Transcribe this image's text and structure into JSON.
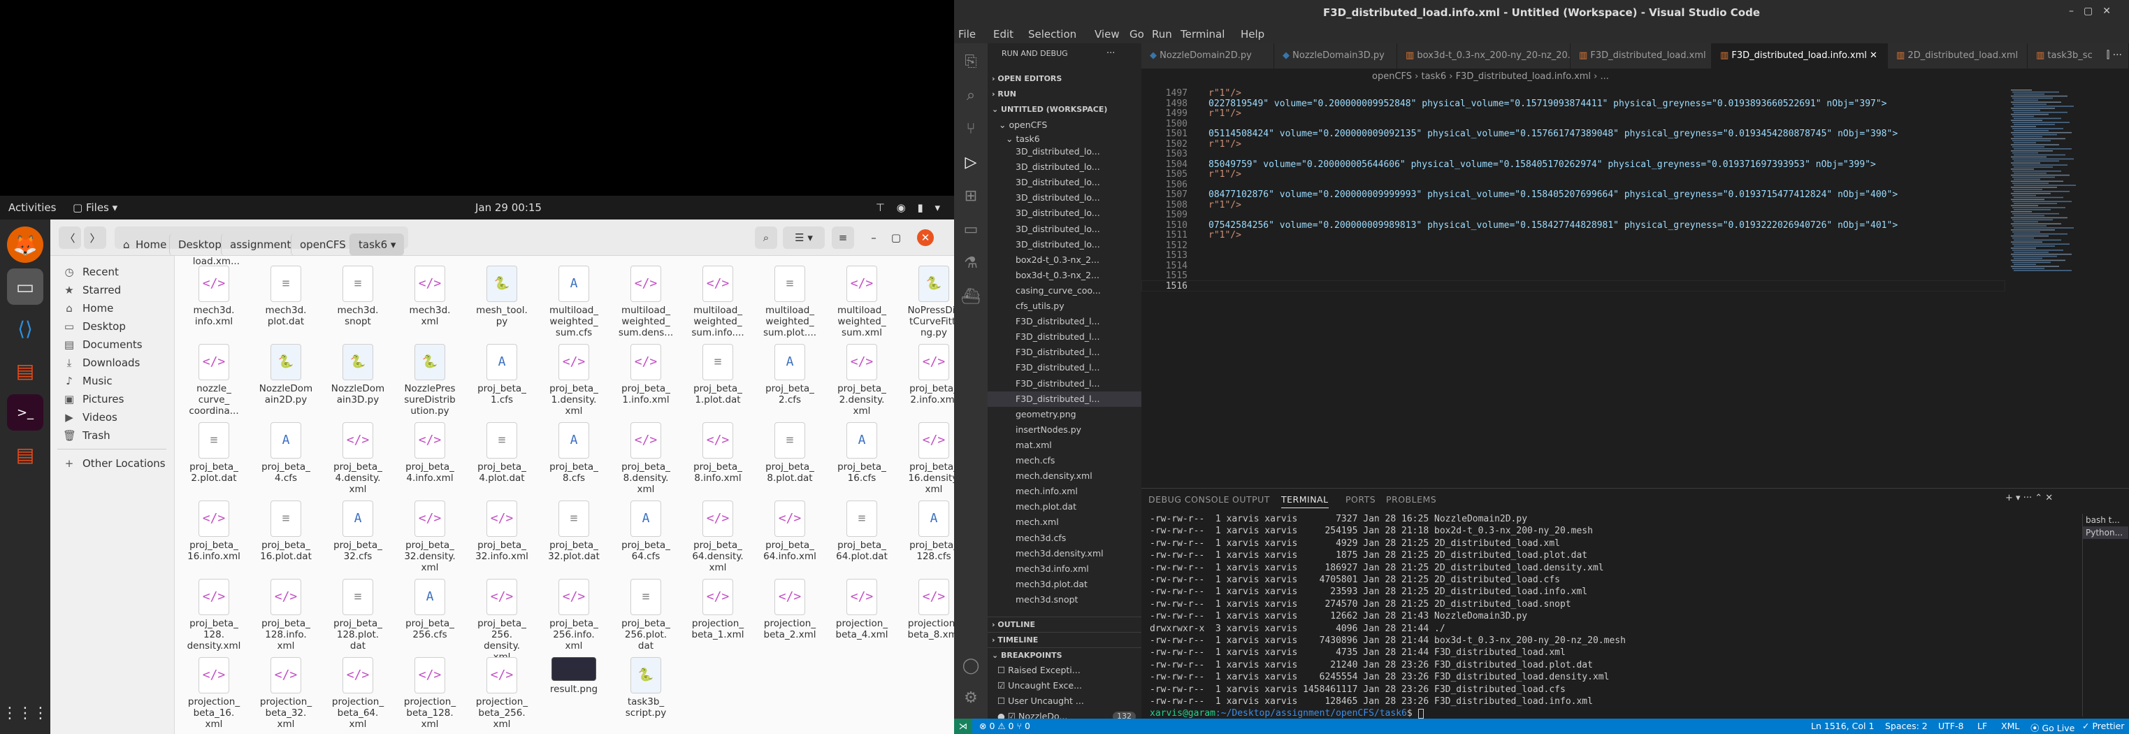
{
  "desktop": {
    "topbar": {
      "activities": "Activities",
      "app": "Files",
      "clock": "Jan 29  00:15",
      "tray": "⊤ ◉ ▮ ▾"
    }
  },
  "files": {
    "nav": {
      "back": "〈",
      "forward": "〉"
    },
    "breadcrumb": [
      "Home",
      "Desktop",
      "assignment",
      "openCFS",
      "task6"
    ],
    "sidebar": [
      {
        "label": "Recent",
        "icon": "clock-icon"
      },
      {
        "label": "Starred",
        "icon": "star-icon"
      },
      {
        "label": "Home",
        "icon": "home-icon"
      },
      {
        "label": "Desktop",
        "icon": "desktop-icon"
      },
      {
        "label": "Documents",
        "icon": "document-icon"
      },
      {
        "label": "Downloads",
        "icon": "download-icon"
      },
      {
        "label": "Music",
        "icon": "music-icon"
      },
      {
        "label": "Pictures",
        "icon": "picture-icon"
      },
      {
        "label": "Videos",
        "icon": "video-icon"
      },
      {
        "label": "Trash",
        "icon": "trash-icon"
      },
      {
        "label": "Other Locations",
        "icon": "plus-icon"
      }
    ],
    "partial_top": "_load.xm...",
    "items": [
      [
        "mech3d.\ninfo.xml",
        "xml"
      ],
      [
        "mech3d.\nplot.dat",
        "txt"
      ],
      [
        "mech3d.\nsnopt",
        "txt"
      ],
      [
        "mech3d.\nxml",
        "xml"
      ],
      [
        "mesh_tool.\npy",
        "py"
      ],
      [
        "multiload_\nweighted_\nsum.cfs",
        "cfs"
      ],
      [
        "multiload_\nweighted_\nsum.dens...",
        "xml"
      ],
      [
        "multiload_\nweighted_\nsum.info....",
        "xml"
      ],
      [
        "multiload_\nweighted_\nsum.plot....",
        "txt"
      ],
      [
        "multiload_\nweighted_\nsum.xml",
        "xml"
      ],
      [
        "NoPressDis\ntCurveFitti\nng.py",
        "py"
      ],
      [
        "nozzle_\ncurve_\ncoordina...",
        "xml"
      ],
      [
        "NozzleDom\nain2D.py",
        "py"
      ],
      [
        "NozzleDom\nain3D.py",
        "py"
      ],
      [
        "NozzlePres\nsureDistrib\nution.py",
        "py"
      ],
      [
        "proj_beta_\n1.cfs",
        "cfs"
      ],
      [
        "proj_beta_\n1.density.\nxml",
        "xml"
      ],
      [
        "proj_beta_\n1.info.xml",
        "xml"
      ],
      [
        "proj_beta_\n1.plot.dat",
        "txt"
      ],
      [
        "proj_beta_\n2.cfs",
        "cfs"
      ],
      [
        "proj_beta_\n2.density.\nxml",
        "xml"
      ],
      [
        "proj_beta_\n2.info.xml",
        "xml"
      ],
      [
        "proj_beta_\n2.plot.dat",
        "txt"
      ],
      [
        "proj_beta_\n4.cfs",
        "cfs"
      ],
      [
        "proj_beta_\n4.density.\nxml",
        "xml"
      ],
      [
        "proj_beta_\n4.info.xml",
        "xml"
      ],
      [
        "proj_beta_\n4.plot.dat",
        "txt"
      ],
      [
        "proj_beta_\n8.cfs",
        "cfs"
      ],
      [
        "proj_beta_\n8.density.\nxml",
        "xml"
      ],
      [
        "proj_beta_\n8.info.xml",
        "xml"
      ],
      [
        "proj_beta_\n8.plot.dat",
        "txt"
      ],
      [
        "proj_beta_\n16.cfs",
        "cfs"
      ],
      [
        "proj_beta_\n16.density.\nxml",
        "xml"
      ],
      [
        "proj_beta_\n16.info.xml",
        "xml"
      ],
      [
        "proj_beta_\n16.plot.dat",
        "txt"
      ],
      [
        "proj_beta_\n32.cfs",
        "cfs"
      ],
      [
        "proj_beta_\n32.density.\nxml",
        "xml"
      ],
      [
        "proj_beta_\n32.info.xml",
        "xml"
      ],
      [
        "proj_beta_\n32.plot.dat",
        "txt"
      ],
      [
        "proj_beta_\n64.cfs",
        "cfs"
      ],
      [
        "proj_beta_\n64.density.\nxml",
        "xml"
      ],
      [
        "proj_beta_\n64.info.xml",
        "xml"
      ],
      [
        "proj_beta_\n64.plot.dat",
        "txt"
      ],
      [
        "proj_beta_\n128.cfs",
        "cfs"
      ],
      [
        "proj_beta_\n128.\ndensity.xml",
        "xml"
      ],
      [
        "proj_beta_\n128.info.\nxml",
        "xml"
      ],
      [
        "proj_beta_\n128.plot.\ndat",
        "txt"
      ],
      [
        "proj_beta_\n256.cfs",
        "cfs"
      ],
      [
        "proj_beta_\n256.\ndensity.\nxml",
        "xml"
      ],
      [
        "proj_beta_\n256.info.\nxml",
        "xml"
      ],
      [
        "proj_beta_\n256.plot.\ndat",
        "txt"
      ],
      [
        "projection_\nbeta_1.xml",
        "xml"
      ],
      [
        "projection_\nbeta_2.xml",
        "xml"
      ],
      [
        "projection_\nbeta_4.xml",
        "xml"
      ],
      [
        "projection_\nbeta_8.xml",
        "xml"
      ],
      [
        "projection_\nbeta_16.\nxml",
        "xml"
      ],
      [
        "projection_\nbeta_32.\nxml",
        "xml"
      ],
      [
        "projection_\nbeta_64.\nxml",
        "xml"
      ],
      [
        "projection_\nbeta_128.\nxml",
        "xml"
      ],
      [
        "projection_\nbeta_256.\nxml",
        "xml"
      ],
      [
        "result.png",
        "png"
      ],
      [
        "task3b_\nscript.py",
        "py"
      ]
    ]
  },
  "vscode": {
    "title": "F3D_distributed_load.info.xml - Untitled (Workspace) - Visual Studio Code",
    "menu": [
      "File",
      "Edit",
      "Selection",
      "View",
      "Go",
      "Run",
      "Terminal",
      "Help"
    ],
    "sidebar": {
      "header": "RUN AND DEBUG",
      "open_editors": "OPEN EDITORS",
      "run": "RUN",
      "workspace": "UNTITLED (WORKSPACE)",
      "folder": "openCFS",
      "subfolder": "task6",
      "files": [
        "3D_distributed_lo...",
        "3D_distributed_lo...",
        "3D_distributed_lo...",
        "3D_distributed_lo...",
        "3D_distributed_lo...",
        "3D_distributed_lo...",
        "3D_distributed_lo...",
        "box2d-t_0.3-nx_2...",
        "box3d-t_0.3-nx_2...",
        "casing_curve_coo...",
        "cfs_utils.py",
        "F3D_distributed_l...",
        "F3D_distributed_l...",
        "F3D_distributed_l...",
        "F3D_distributed_l...",
        "F3D_distributed_l...",
        "F3D_distributed_l...",
        "geometry.png",
        "insertNodes.py",
        "mat.xml",
        "mech.cfs",
        "mech.density.xml",
        "mech.info.xml",
        "mech.plot.dat",
        "mech.xml",
        "mech3d.cfs",
        "mech3d.density.xml",
        "mech3d.info.xml",
        "mech3d.plot.dat",
        "mech3d.snopt"
      ],
      "outline": "OUTLINE",
      "timeline": "TIMELINE",
      "breakpoints": "BREAKPOINTS",
      "bp_items": [
        "Raised Excepti...",
        "Uncaught Exce...",
        "User Uncaught ...",
        "NozzleDo..."
      ],
      "bp_count": "132"
    },
    "tabs": [
      "NozzleDomain2D.py",
      "NozzleDomain3D.py",
      "box3d-t_0.3-nx_200-ny_20-nz_20.mesh",
      "F3D_distributed_load.xml",
      "F3D_distributed_load.info.xml",
      "2D_distributed_load.xml",
      "task3b_sc"
    ],
    "breadcrumb": "openCFS  ›  task6  ›  F3D_distributed_load.info.xml  ›  ...",
    "lines": [
      [
        "1497",
        "r\"1\"/>"
      ],
      [
        "1498",
        "0227819549\" volume=\"0.200000009952848\" physical_volume=\"0.15719093874411\" physical_greyness=\"0.0193893660522691\" nObj=\"397\">"
      ],
      [
        "1499",
        "r\"1\"/>"
      ],
      [
        "1500",
        ""
      ],
      [
        "1501",
        "05114508424\" volume=\"0.200000009092135\" physical_volume=\"0.157661747389048\" physical_greyness=\"0.0193454280878745\" nObj=\"398\">"
      ],
      [
        "1502",
        "r\"1\"/>"
      ],
      [
        "1503",
        ""
      ],
      [
        "1504",
        "85049759\" volume=\"0.200000005644606\" physical_volume=\"0.158405170262974\" physical_greyness=\"0.019371697393953\" nObj=\"399\">"
      ],
      [
        "1505",
        "r\"1\"/>"
      ],
      [
        "1506",
        ""
      ],
      [
        "1507",
        "08477102876\" volume=\"0.200000009999993\" physical_volume=\"0.158405207699664\" physical_greyness=\"0.0193715477412824\" nObj=\"400\">"
      ],
      [
        "1508",
        "r\"1\"/>"
      ],
      [
        "1509",
        ""
      ],
      [
        "1510",
        "07542584256\" volume=\"0.200000009989813\" physical_volume=\"0.158427744828981\" physical_greyness=\"0.0193222026940726\" nObj=\"401\">"
      ],
      [
        "1511",
        "r\"1\"/>"
      ],
      [
        "1512",
        ""
      ],
      [
        "1513",
        ""
      ],
      [
        "1514",
        ""
      ],
      [
        "1515",
        ""
      ],
      [
        "1516",
        ""
      ]
    ],
    "panel_tabs": [
      "DEBUG CONSOLE",
      "OUTPUT",
      "TERMINAL",
      "PORTS",
      "PROBLEMS"
    ],
    "terminal": [
      "-rw-rw-r--  1 xarvis xarvis       7327 Jan 28 16:25 NozzleDomain2D.py",
      "-rw-rw-r--  1 xarvis xarvis     254195 Jan 28 21:18 box2d-t_0.3-nx_200-ny_20.mesh",
      "-rw-rw-r--  1 xarvis xarvis       4929 Jan 28 21:25 2D_distributed_load.xml",
      "-rw-rw-r--  1 xarvis xarvis       1875 Jan 28 21:25 2D_distributed_load.plot.dat",
      "-rw-rw-r--  1 xarvis xarvis     186927 Jan 28 21:25 2D_distributed_load.density.xml",
      "-rw-rw-r--  1 xarvis xarvis    4705801 Jan 28 21:25 2D_distributed_load.cfs",
      "-rw-rw-r--  1 xarvis xarvis      23593 Jan 28 21:25 2D_distributed_load.info.xml",
      "-rw-rw-r--  1 xarvis xarvis     274570 Jan 28 21:25 2D_distributed_load.snopt",
      "-rw-rw-r--  1 xarvis xarvis      12662 Jan 28 21:43 NozzleDomain3D.py",
      "drwxrwxr-x  3 xarvis xarvis       4096 Jan 28 21:44 ./",
      "-rw-rw-r--  1 xarvis xarvis    7430896 Jan 28 21:44 box3d-t_0.3-nx_200-ny_20-nz_20.mesh",
      "-rw-rw-r--  1 xarvis xarvis       4735 Jan 28 21:44 F3D_distributed_load.xml",
      "-rw-rw-r--  1 xarvis xarvis      21240 Jan 28 23:26 F3D_distributed_load.plot.dat",
      "-rw-rw-r--  1 xarvis xarvis    6245554 Jan 28 23:26 F3D_distributed_load.density.xml",
      "-rw-rw-r--  1 xarvis xarvis 1458461117 Jan 28 23:26 F3D_distributed_load.cfs",
      "-rw-rw-r--  1 xarvis xarvis     128465 Jan 28 23:26 F3D_distributed_load.info.xml"
    ],
    "prompt_user": "xarvis@garam",
    "prompt_path": ":~/Desktop/assignment/openCFS/task6",
    "prompt_end": "$ ",
    "term_list": [
      "bash t...",
      "Python..."
    ],
    "status": {
      "left": "⊗ 0 ⚠ 0   ⑂ 0",
      "ln": "Ln 1516, Col 1",
      "spaces": "Spaces: 2",
      "enc": "UTF-8",
      "eol": "LF",
      "lang": "XML",
      "live": "⦿ Go Live",
      "prettier": "✓ Prettier"
    }
  }
}
